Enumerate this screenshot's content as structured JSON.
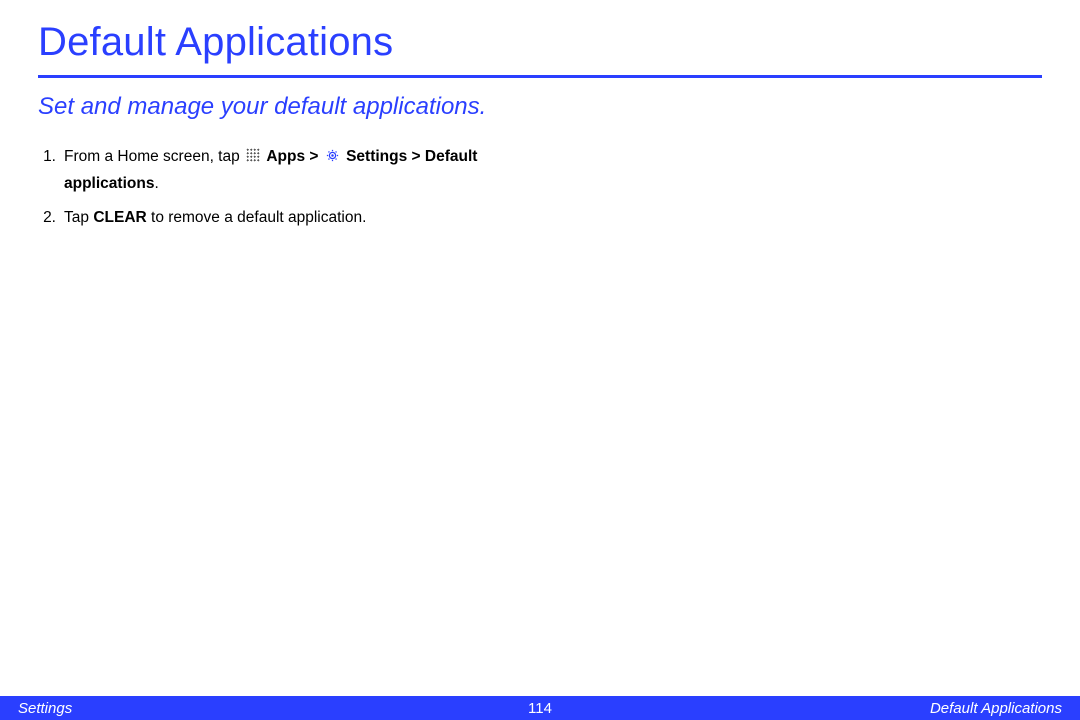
{
  "title": "Default Applications",
  "subtitle": "Set and manage your default applications.",
  "steps": [
    {
      "num": "1.",
      "pre": "From a Home screen, tap ",
      "apps_label": "Apps",
      "sep1": " > ",
      "settings_label": "Settings",
      "sep2": " > ",
      "default_apps_label": "Default applications",
      "period": "."
    },
    {
      "num": "2.",
      "pre": "Tap ",
      "clear_label": "CLEAR",
      "post": " to remove a default application."
    }
  ],
  "footer": {
    "left": "Settings",
    "center": "114",
    "right": "Default Applications"
  }
}
